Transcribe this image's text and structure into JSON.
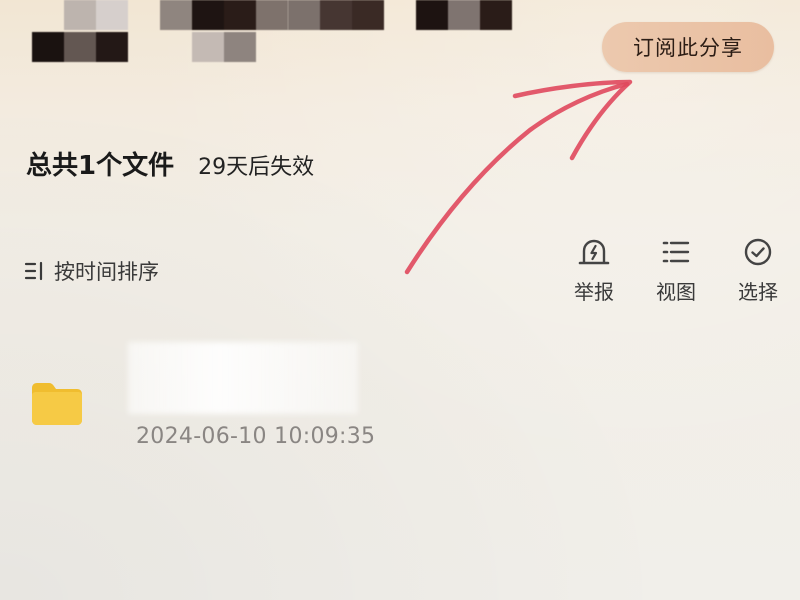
{
  "header": {
    "subscribe_label": "订阅此分享"
  },
  "summary": {
    "file_count": "总共1个文件",
    "expiry": "29天后失效"
  },
  "toolbar": {
    "sort_label": "按时间排序",
    "report_label": "举报",
    "view_label": "视图",
    "select_label": "选择"
  },
  "files": [
    {
      "name": "",
      "date": "2024-06-10 10:09:35",
      "icon": "folder-icon"
    }
  ],
  "icons": {
    "sort": "sort-lines-icon",
    "report": "alarm-light-icon",
    "view": "list-view-icon",
    "select": "check-circle-icon"
  },
  "colors": {
    "subscribe_bg": "#eac4a8",
    "folder": "#f5c842",
    "annotation_arrow": "#e0485d"
  }
}
